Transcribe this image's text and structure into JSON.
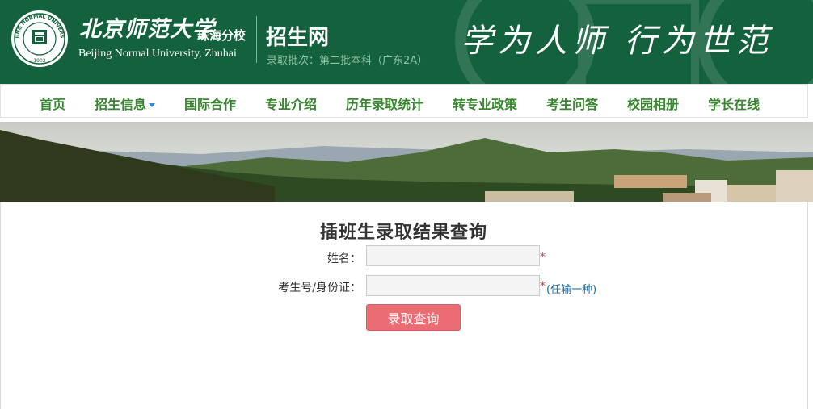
{
  "colors": {
    "header_bg": "#14623d",
    "nav_text": "#37872f",
    "button_bg": "#ec6c74",
    "required": "#e4393c",
    "hint_text": "#1a6ca8"
  },
  "header": {
    "emblem_text": "BEIJING NORMAL UNIVERSITY",
    "emblem_year": "1902",
    "university_cn": "北京师范大学",
    "campus_cn": "珠海分校",
    "university_en": "Beijing Normal University, Zhuhai",
    "site_title": "招生网",
    "batch_label": "录取批次：第二批本科（广东2A）",
    "motto": "学为人师 行为世范"
  },
  "nav": {
    "items": [
      {
        "label": "首页"
      },
      {
        "label": "招生信息",
        "icon": "caret-down-icon"
      },
      {
        "label": "国际合作"
      },
      {
        "label": "专业介绍"
      },
      {
        "label": "历年录取统计"
      },
      {
        "label": "转专业政策"
      },
      {
        "label": "考生问答"
      },
      {
        "label": "校园相册"
      },
      {
        "label": "学长在线"
      }
    ]
  },
  "form": {
    "title": "插班生录取结果查询",
    "name_label": "姓名：",
    "name_value": "",
    "id_label": "考生号/身份证：",
    "id_value": "",
    "required_mark": "*",
    "id_hint": "(任输一种)",
    "submit_label": "录取查询"
  }
}
